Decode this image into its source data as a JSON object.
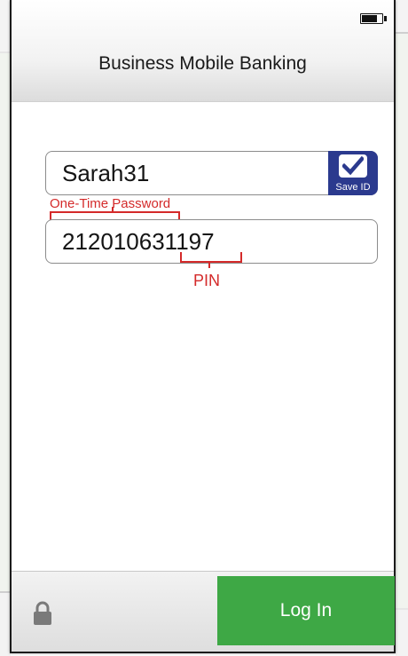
{
  "header": {
    "title": "Business Mobile Banking",
    "battery_icon": "battery-icon"
  },
  "form": {
    "user_id_value": "Sarah31",
    "save_id_label": "Save ID",
    "save_id_checked": true,
    "password_value": "212010631197"
  },
  "annotations": {
    "otp_label": "One-Time Password",
    "pin_label": "PIN",
    "color": "#d42a2a"
  },
  "footer": {
    "lock_icon": "lock-icon",
    "login_label": "Log In",
    "login_color": "#3ea845"
  },
  "colors": {
    "save_id_bg": "#2b3a8e"
  }
}
